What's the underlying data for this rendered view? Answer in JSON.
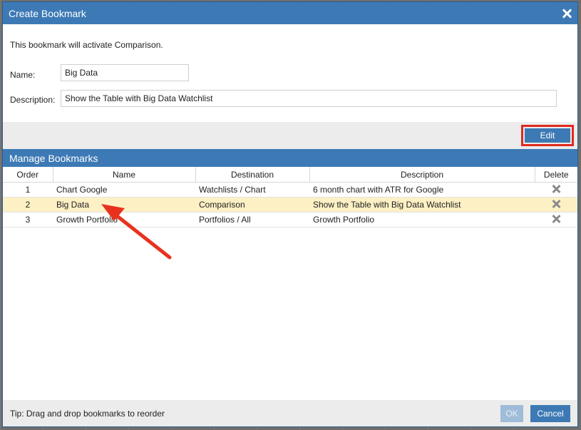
{
  "dialog": {
    "title": "Create Bookmark",
    "close_icon": "close-icon"
  },
  "form": {
    "info_text": "This bookmark will activate Comparison.",
    "name_label": "Name:",
    "name_value": "Big Data",
    "description_label": "Description:",
    "description_value": "Show the Table with Big Data Watchlist"
  },
  "toolbar": {
    "edit_label": "Edit",
    "highlight_color": "#e02a1e"
  },
  "manage": {
    "title": "Manage Bookmarks",
    "columns": [
      "Order",
      "Name",
      "Destination",
      "Description",
      "Delete"
    ],
    "rows": [
      {
        "order": "1",
        "name": "Chart Google",
        "destination": "Watchlists / Chart",
        "description": "6 month chart with ATR for Google",
        "delete_icon": "close-x-icon"
      },
      {
        "order": "2",
        "name": "Big Data",
        "destination": "Comparison",
        "description": "Show the Table with Big Data Watchlist",
        "delete_icon": "close-x-icon",
        "selected": true
      },
      {
        "order": "3",
        "name": "Growth Portfolio",
        "destination": "Portfolios / All",
        "description": "Growth Portfolio",
        "delete_icon": "close-x-icon"
      }
    ]
  },
  "footer": {
    "tip": "Tip: Drag and drop bookmarks to reorder",
    "ok_label": "OK",
    "cancel_label": "Cancel"
  },
  "colors": {
    "accent": "#3d7ab5",
    "selected_row": "#fdf0c4",
    "annotation_arrow": "#e8321f"
  }
}
